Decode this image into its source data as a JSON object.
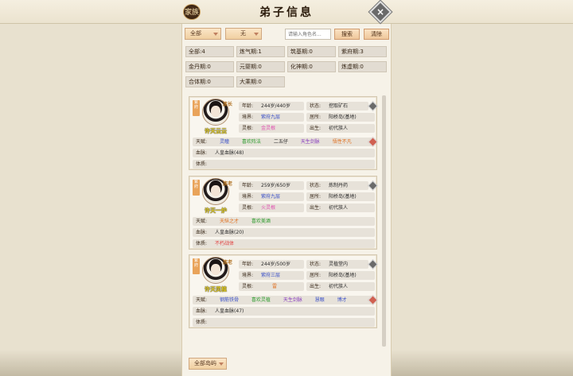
{
  "header": {
    "clan_label": "家族",
    "title": "弟子信息"
  },
  "filters": {
    "filter1": "全部",
    "filter2": "无",
    "search_placeholder": "请输入角色名...",
    "search_label": "搜索",
    "clear_label": "清除"
  },
  "stages": [
    {
      "label": "全部:4"
    },
    {
      "label": "炼气期:1"
    },
    {
      "label": "筑基期:0"
    },
    {
      "label": "紫府期:3"
    },
    {
      "label": "金丹期:0"
    },
    {
      "label": "元婴期:0"
    },
    {
      "label": "化神期:0"
    },
    {
      "label": "炼虚期:0"
    },
    {
      "label": "合体期:0"
    },
    {
      "label": "大乘期:0"
    }
  ],
  "labels": {
    "age": "年龄:",
    "status": "状态:",
    "realm": "境界:",
    "residence": "居所:",
    "root": "灵根:",
    "birth": "出生:",
    "talent": "天赋:",
    "bloodline": "血脉:",
    "physique": "体质:"
  },
  "disciples": [
    {
      "tag": "紫府",
      "role": "族长",
      "name": "许天云云",
      "age": "244岁/440岁",
      "status": "挖取矿石",
      "realm": "紫府九层",
      "residence": "阳桥岛(基地)",
      "root": "金灵根",
      "birth": "初代族人",
      "talents": [
        {
          "text": "灵瞳",
          "color": "#3a50c8"
        },
        {
          "text": "喜欢阵法",
          "color": "#2a9a2a"
        },
        {
          "text": "二五仔",
          "color": "#2a2a2a"
        },
        {
          "text": "天生剑脉",
          "color": "#8a40c0"
        },
        {
          "text": "悟性不凡",
          "color": "#e07020"
        }
      ],
      "bloodline": "人皇血脉(48)",
      "physique": ""
    },
    {
      "tag": "紫府",
      "role": "族老",
      "name": "许天一炉",
      "age": "259岁/650岁",
      "status": "炼制丹药",
      "realm": "紫府九层",
      "residence": "阳桥岛(基地)",
      "root": "火灵根",
      "birth": "初代族人",
      "talents": [
        {
          "text": "天纵之才",
          "color": "#e07020"
        },
        {
          "text": "喜欢美酒",
          "color": "#2a9a2a"
        }
      ],
      "bloodline": "人皇血脉(20)",
      "physique": "不朽战体"
    },
    {
      "tag": "紫府",
      "role": "族老",
      "name": "许天灵植",
      "age": "244岁/500岁",
      "status": "灵植堂内",
      "realm": "紫府三层",
      "residence": "阳桥岛(基地)",
      "root": "雷",
      "birth": "初代族人",
      "talents": [
        {
          "text": "钢筋铁骨",
          "color": "#3a50c8"
        },
        {
          "text": "喜欢灵植",
          "color": "#2a9a2a"
        },
        {
          "text": "天生剑脉",
          "color": "#8a40c0"
        },
        {
          "text": "慧眼",
          "color": "#3a50c8"
        },
        {
          "text": "博才",
          "color": "#3a50c8"
        }
      ],
      "bloodline": "人皇血脉(47)",
      "physique": ""
    }
  ],
  "footer": {
    "island_filter": "全部岛屿"
  }
}
